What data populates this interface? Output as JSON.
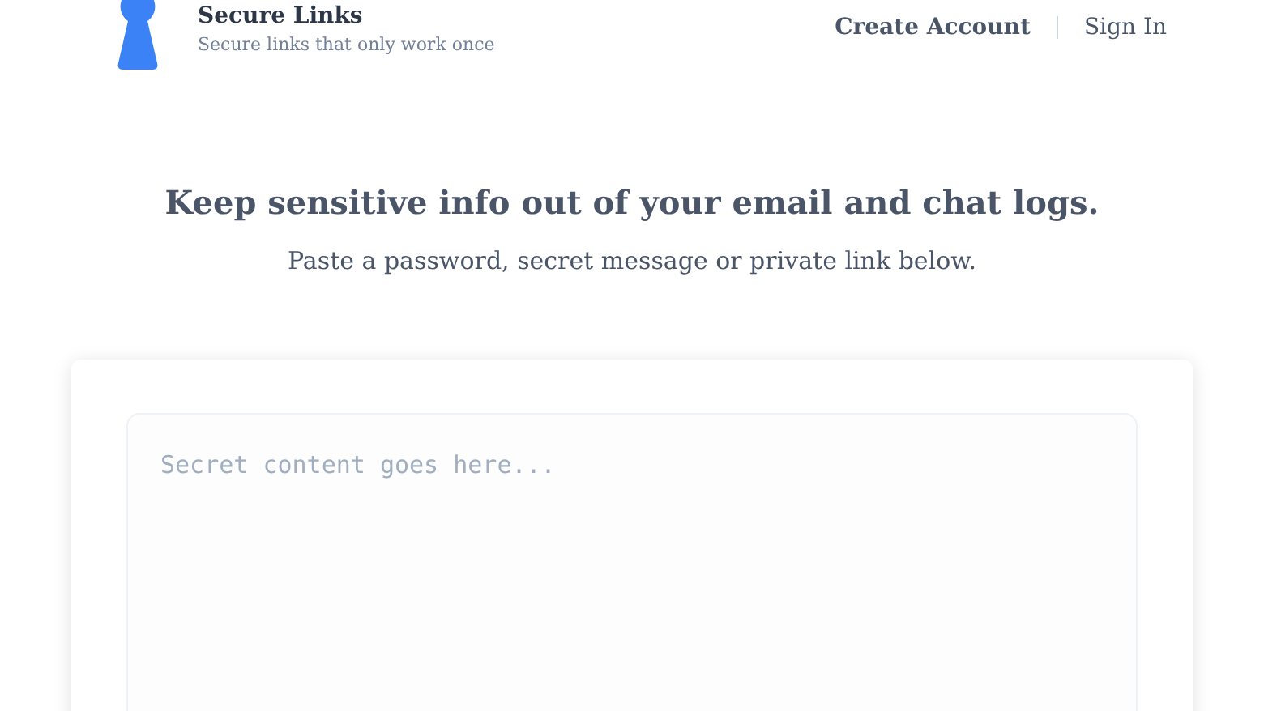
{
  "brand": {
    "name": "Secure Links",
    "tagline": "Secure links that only work once"
  },
  "nav": [
    {
      "label": "Create Account",
      "kind": "primary"
    },
    {
      "label": "Sign In",
      "kind": "plain"
    }
  ],
  "hero": {
    "heading": "Keep sensitive info out of your email and chat logs.",
    "subheading": "Paste a password, secret message or private link below."
  },
  "form": {
    "secret": {
      "placeholder": "Secret content goes here..."
    }
  }
}
